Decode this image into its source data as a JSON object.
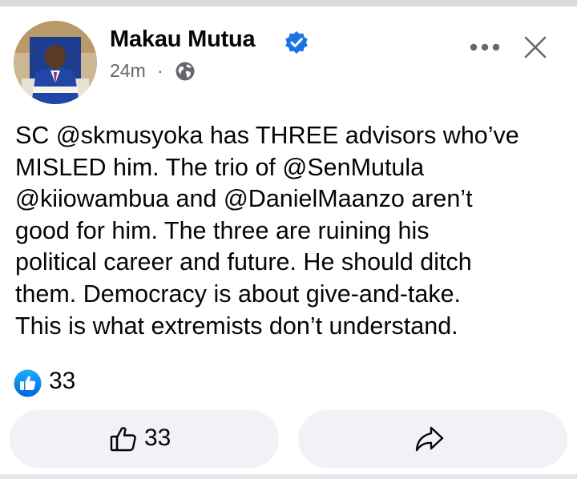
{
  "post": {
    "author": {
      "name": "Makau Mutua",
      "verified": true,
      "avatar": "profile-photo"
    },
    "timestamp": "24m",
    "separator": "·",
    "audience_icon": "globe-icon",
    "menu_icons": [
      "more-options-icon",
      "close-icon"
    ],
    "text": "SC @skmusyoka has THREE advisors who’ve\nMISLED him. The trio of @SenMutula\n@kiiowambua and @DanielMaanzo aren’t\ngood for him. The three are ruining his\npolitical career and future. He should ditch\nthem. Democracy is about give-and-take.\nThis is what extremists don’t understand.",
    "reactions": {
      "icon": "like-reaction-icon",
      "count": "33"
    },
    "actions": {
      "like": {
        "icon": "thumbs-up-icon",
        "count": "33"
      },
      "share": {
        "icon": "share-arrow-icon"
      }
    }
  },
  "colors": {
    "brand_blue": "#1b74e4",
    "text_primary": "#050505",
    "text_secondary": "#65676b",
    "button_bg": "#f0f2f5"
  }
}
